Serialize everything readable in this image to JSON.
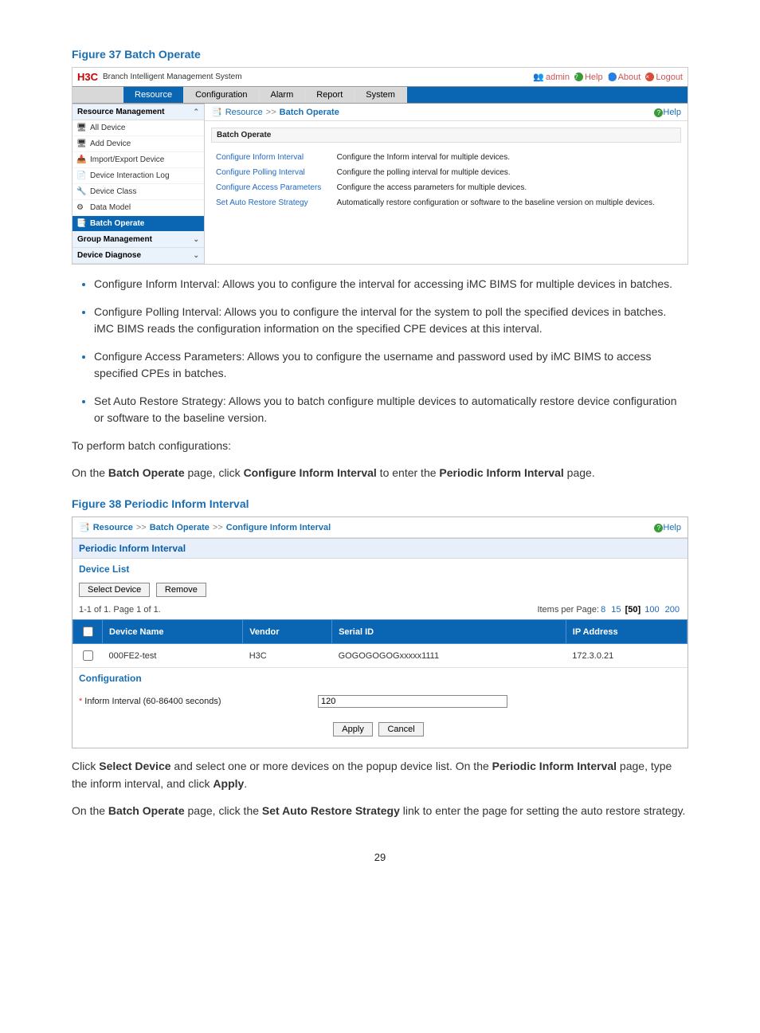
{
  "figure37": {
    "title": "Figure 37 Batch Operate",
    "brand_logo": "H3C",
    "brand_sub": "Branch Intelligent Management System",
    "top_user_label": "admin",
    "top_help": "Help",
    "top_about": "About",
    "top_logout": "Logout",
    "menus": {
      "resource": "Resource",
      "configuration": "Configuration",
      "alarm": "Alarm",
      "report": "Report",
      "system": "System"
    },
    "nav": {
      "head1": "Resource Management",
      "all_device": "All Device",
      "add_device": "Add Device",
      "import_export": "Import/Export Device",
      "interaction": "Device Interaction Log",
      "device_class": "Device Class",
      "data_model": "Data Model",
      "batch_operate": "Batch Operate",
      "head2": "Group Management",
      "head3": "Device Diagnose"
    },
    "bc_resource": "Resource",
    "bc_batch": "Batch Operate",
    "help": "Help",
    "panel_title": "Batch Operate",
    "rows": [
      {
        "link": "Configure Inform Interval",
        "desc": "Configure the Inform interval for multiple devices."
      },
      {
        "link": "Configure Polling Interval",
        "desc": "Configure the polling interval for multiple devices."
      },
      {
        "link": "Configure Access Parameters",
        "desc": "Configure the access parameters for multiple devices."
      },
      {
        "link": "Set Auto Restore Strategy",
        "desc": "Automatically restore configuration or software to the baseline version on multiple devices."
      }
    ]
  },
  "bullets": [
    "Configure Inform Interval: Allows you to configure the interval for accessing iMC BIMS for multiple devices in batches.",
    "Configure Polling Interval: Allows you to configure the interval for the system to poll the specified devices in batches. iMC BIMS reads the configuration information on the specified CPE devices at this interval.",
    "Configure Access Parameters: Allows you to configure the username and password used by iMC BIMS to access specified CPEs in batches.",
    "Set Auto Restore Strategy: Allows you to batch configure multiple devices to automatically restore device configuration or software to the baseline version."
  ],
  "para_perform": "To perform batch configurations:",
  "para_onbatch_pre": "On the ",
  "para_onbatch_b1": "Batch Operate",
  "para_onbatch_mid": " page, click ",
  "para_onbatch_b2": "Configure Inform Interval",
  "para_onbatch_mid2": " to enter the ",
  "para_onbatch_b3": "Periodic Inform Interval",
  "para_onbatch_post": " page.",
  "figure38": {
    "title": "Figure 38 Periodic Inform Interval",
    "bc_resource": "Resource",
    "bc_batch": "Batch Operate",
    "bc_conf": "Configure Inform Interval",
    "help": "Help",
    "sec_periodic": "Periodic Inform Interval",
    "device_list": "Device List",
    "btn_select": "Select Device",
    "btn_remove": "Remove",
    "pager_left": "1-1 of 1. Page 1 of 1.",
    "pager_label": "Items per Page:",
    "pp": [
      "8",
      "15",
      "[50]",
      "100",
      "200"
    ],
    "cols": {
      "name": "Device Name",
      "vendor": "Vendor",
      "serial": "Serial ID",
      "ip": "IP Address"
    },
    "row": {
      "name": "000FE2-test",
      "vendor": "H3C",
      "serial": "GOGOGOGOGxxxxx1111",
      "ip": "172.3.0.21"
    },
    "sec_config": "Configuration",
    "inform_label": "Inform Interval (60-86400 seconds)",
    "inform_value": "120",
    "btn_apply": "Apply",
    "btn_cancel": "Cancel"
  },
  "para_click_pre": "Click ",
  "para_click_b1": "Select Device",
  "para_click_mid": " and select one or more devices on the popup device list. On the ",
  "para_click_b2": "Periodic Inform Interval",
  "para_click_mid2": " page, type the inform interval, and click ",
  "para_click_b3": "Apply",
  "para_click_post": ".",
  "para_last_pre": "On the ",
  "para_last_b1": "Batch Operate",
  "para_last_mid": " page, click the ",
  "para_last_b2": "Set Auto Restore Strategy",
  "para_last_post": " link to enter the page for setting the auto restore strategy.",
  "pagenum": "29"
}
